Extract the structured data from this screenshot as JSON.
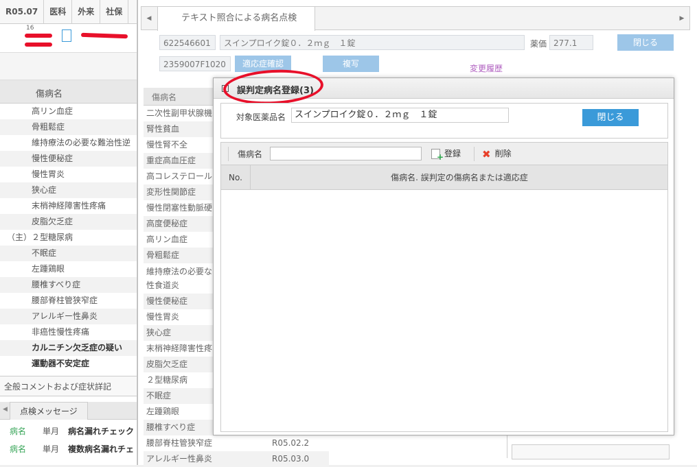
{
  "top_tabs": [
    "R05.07",
    "医科",
    "外来",
    "社保"
  ],
  "patient": {
    "small_num": "16"
  },
  "left_panel": {
    "header": "傷病名",
    "diagnoses": [
      {
        "mark": "",
        "name": "高リン血症",
        "bold": false
      },
      {
        "mark": "",
        "name": "骨粗鬆症",
        "bold": false
      },
      {
        "mark": "",
        "name": "維持療法の必要な難治性逆",
        "bold": false
      },
      {
        "mark": "",
        "name": "慢性便秘症",
        "bold": false
      },
      {
        "mark": "",
        "name": "慢性胃炎",
        "bold": false
      },
      {
        "mark": "",
        "name": "狭心症",
        "bold": false
      },
      {
        "mark": "",
        "name": "末梢神経障害性疼痛",
        "bold": false
      },
      {
        "mark": "",
        "name": "皮脂欠乏症",
        "bold": false
      },
      {
        "mark": "（主）",
        "name": "２型糖尿病",
        "bold": false
      },
      {
        "mark": "",
        "name": "不眠症",
        "bold": false
      },
      {
        "mark": "",
        "name": "左踵鶏眼",
        "bold": false
      },
      {
        "mark": "",
        "name": "腰椎すべり症",
        "bold": false
      },
      {
        "mark": "",
        "name": "腰部脊柱管狭窄症",
        "bold": false
      },
      {
        "mark": "",
        "name": "アレルギー性鼻炎",
        "bold": false
      },
      {
        "mark": "",
        "name": "非癌性慢性疼痛",
        "bold": false
      },
      {
        "mark": "",
        "name": "カルニチン欠乏症の疑い",
        "bold": true
      },
      {
        "mark": "",
        "name": "運動器不安定症",
        "bold": true
      }
    ],
    "comment_label": "全般コメントおよび症状詳記",
    "message_tab": "点検メッセージ",
    "messages": [
      {
        "type": "病名",
        "period": "単月",
        "text": "病名漏れチェック"
      },
      {
        "type": "病名",
        "period": "単月",
        "text": "複数病名漏れチェ"
      }
    ]
  },
  "main": {
    "tab_title": "テキスト照合による病名点検",
    "drug_code": "622546601",
    "drug_name": "スインプロイク錠０．２ｍｇ　１錠",
    "price_label": "薬価",
    "price_value": "277.1",
    "close_label": "閉じる",
    "receipt_code": "2359007F1020",
    "indication_button": "適応症確認",
    "copy_button": "複写",
    "history_link": "変更履歴",
    "list_header": "傷病名",
    "list": [
      {
        "name": "二次性副甲状腺機",
        "date": ""
      },
      {
        "name": "腎性貧血",
        "date": ""
      },
      {
        "name": "慢性腎不全",
        "date": ""
      },
      {
        "name": "重症高血圧症",
        "date": ""
      },
      {
        "name": "高コレステロール",
        "date": ""
      },
      {
        "name": "変形性関節症",
        "date": ""
      },
      {
        "name": "慢性閉塞性動脈硬",
        "date": ""
      },
      {
        "name": "高度便秘症",
        "date": ""
      },
      {
        "name": "高リン血症",
        "date": ""
      },
      {
        "name": "骨粗鬆症",
        "date": ""
      },
      {
        "name": "維持療法の必要な性食道炎",
        "date": "",
        "tall": true
      },
      {
        "name": "慢性便秘症",
        "date": ""
      },
      {
        "name": "慢性胃炎",
        "date": ""
      },
      {
        "name": "狭心症",
        "date": ""
      },
      {
        "name": "末梢神経障害性疼",
        "date": ""
      },
      {
        "name": "皮脂欠乏症",
        "date": ""
      },
      {
        "name": "２型糖尿病",
        "date": ""
      },
      {
        "name": "不眠症",
        "date": ""
      },
      {
        "name": "左踵鶏眼",
        "date": ""
      },
      {
        "name": "腰椎すべり症",
        "date": ""
      },
      {
        "name": "腰部脊柱管狭窄症",
        "date": "R05.02.2"
      },
      {
        "name": "アレルギー性鼻炎",
        "date": "R05.03.0"
      }
    ]
  },
  "dialog": {
    "title": "誤判定病名登録(3)",
    "drug_label": "対象医薬品名",
    "drug_value": "スインプロイク錠０．２ｍｇ　１錠",
    "close_label": "閉じる",
    "disease_label": "傷病名",
    "disease_input": "",
    "register_label": "登録",
    "delete_label": "削除",
    "col_no": "No.",
    "col_name": "傷病名. 誤判定の傷病名または適応症",
    "rows": []
  },
  "colors": {
    "accent_button": "#3a9ad9",
    "disabled_button": "#9dc6e8",
    "annotation_red": "#e8102a",
    "history_link": "#b060c0",
    "message_type": "#3aa65a"
  }
}
